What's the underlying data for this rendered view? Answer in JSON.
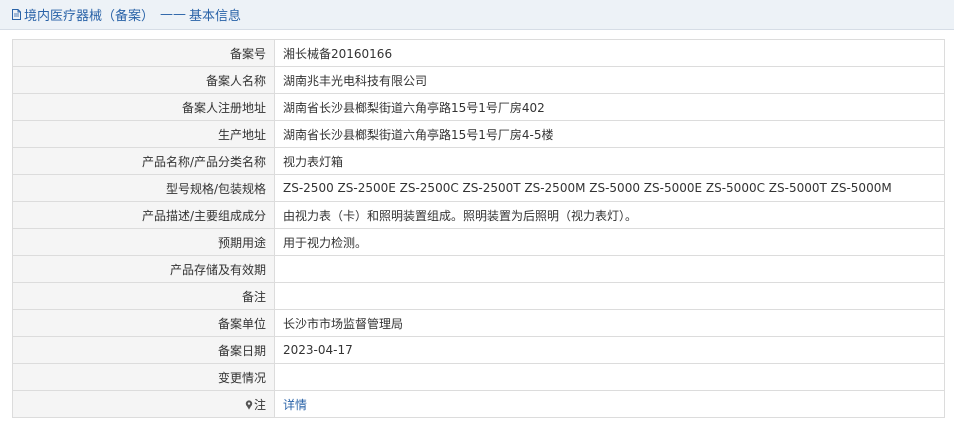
{
  "header": {
    "title": "境内医疗器械（备案）",
    "separator": "——",
    "subtitle": "基本信息",
    "icon": "document-icon"
  },
  "rows": [
    {
      "label": "备案号",
      "value": "湘长械备20160166"
    },
    {
      "label": "备案人名称",
      "value": "湖南兆丰光电科技有限公司"
    },
    {
      "label": "备案人注册地址",
      "value": "湖南省长沙县榔梨街道六角亭路15号1号厂房402"
    },
    {
      "label": "生产地址",
      "value": "湖南省长沙县榔梨街道六角亭路15号1号厂房4-5楼"
    },
    {
      "label": "产品名称/产品分类名称",
      "value": "视力表灯箱"
    },
    {
      "label": "型号规格/包装规格",
      "value": "ZS-2500 ZS-2500E ZS-2500C ZS-2500T ZS-2500M ZS-5000 ZS-5000E ZS-5000C ZS-5000T ZS-5000M"
    },
    {
      "label": "产品描述/主要组成成分",
      "value": "由视力表（卡）和照明装置组成。照明装置为后照明（视力表灯）。"
    },
    {
      "label": "预期用途",
      "value": "用于视力检测。"
    },
    {
      "label": "产品存储及有效期",
      "value": ""
    },
    {
      "label": "备注",
      "value": ""
    },
    {
      "label": "备案单位",
      "value": "长沙市市场监督管理局"
    },
    {
      "label": "备案日期",
      "value": "2023-04-17"
    },
    {
      "label": "变更情况",
      "value": ""
    }
  ],
  "note_row": {
    "label": "注",
    "link_text": "详情",
    "icon": "pin-icon"
  },
  "colors": {
    "accent": "#2a63a8",
    "header_bg": "#edf2f7",
    "label_bg": "#f5f5f5",
    "border": "#dcdcdc"
  }
}
